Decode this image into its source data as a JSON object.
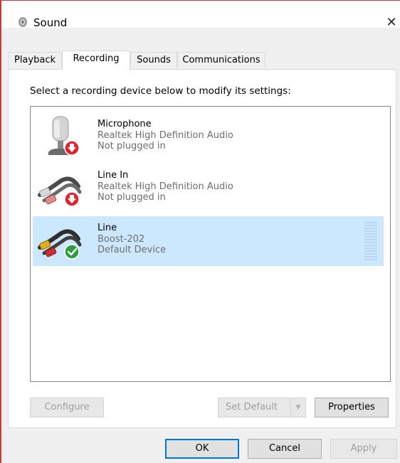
{
  "window": {
    "title": "Sound",
    "close_glyph": "✕"
  },
  "tabs": [
    {
      "label": "Playback"
    },
    {
      "label": "Recording"
    },
    {
      "label": "Sounds"
    },
    {
      "label": "Communications"
    }
  ],
  "active_tab": "Recording",
  "instruction": "Select a recording device below to modify its settings:",
  "devices": [
    {
      "name": "Microphone",
      "driver": "Realtek High Definition Audio",
      "status": "Not plugged in",
      "icon": "microphone-icon",
      "badge": "unplugged-badge",
      "selected": false
    },
    {
      "name": "Line In",
      "driver": "Realtek High Definition Audio",
      "status": "Not plugged in",
      "icon": "rca-cable-icon",
      "badge": "unplugged-badge",
      "selected": false
    },
    {
      "name": "Line",
      "driver": "Boost-202",
      "status": "Default Device",
      "icon": "rca-cable-icon",
      "badge": "default-check-badge",
      "selected": true
    }
  ],
  "buttons": {
    "configure": "Configure",
    "set_default": "Set Default",
    "properties": "Properties",
    "ok": "OK",
    "cancel": "Cancel",
    "apply": "Apply"
  },
  "colors": {
    "selection": "#cce8ff",
    "accent": "#0078d7",
    "unplugged_badge": "#e0232e",
    "default_badge": "#2e9b40"
  }
}
